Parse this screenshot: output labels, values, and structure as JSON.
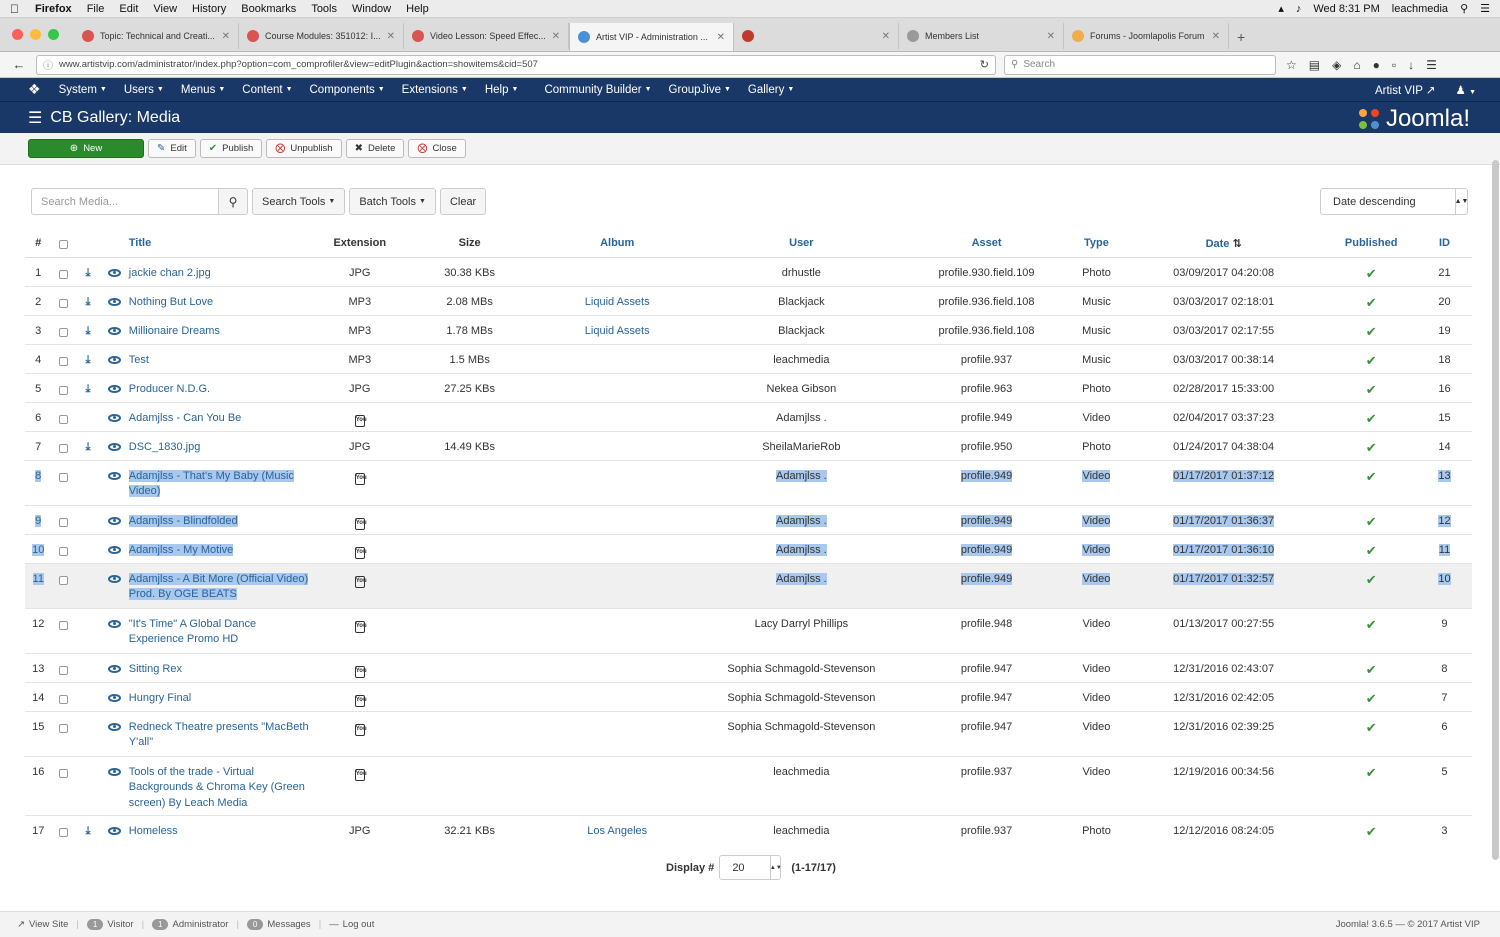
{
  "macbar": {
    "app": "Firefox",
    "menus": [
      "File",
      "Edit",
      "View",
      "History",
      "Bookmarks",
      "Tools",
      "Window",
      "Help"
    ],
    "clock": "Wed 8:31 PM",
    "user": "leachmedia"
  },
  "tabs": [
    {
      "label": "Topic: Technical and Creati...",
      "color": "#d9534f"
    },
    {
      "label": "Course Modules: 351012: I...",
      "color": "#d9534f"
    },
    {
      "label": "Video Lesson: Speed Effec...",
      "color": "#d9534f"
    },
    {
      "label": "Artist VIP - Administration ...",
      "color": "#4a90d9"
    },
    {
      "label": "",
      "color": "#c0392b"
    },
    {
      "label": "Members List",
      "color": "#999999"
    },
    {
      "label": "Forums - Joomlapolis Forum",
      "color": "#f0ad4e"
    }
  ],
  "url": "www.artistvip.com/administrator/index.php?option=com_comprofiler&view=editPlugin&action=showitems&cid=507",
  "search_placeholder": "Search",
  "jnav": {
    "items": [
      "System",
      "Users",
      "Menus",
      "Content",
      "Components",
      "Extensions",
      "Help",
      "Community Builder",
      "GroupJive",
      "Gallery"
    ],
    "site_link": "Artist VIP"
  },
  "page_title": "CB Gallery: Media",
  "brand": "Joomla!",
  "toolbar": {
    "new": "New",
    "edit": "Edit",
    "publish": "Publish",
    "unpublish": "Unpublish",
    "delete": "Delete",
    "close": "Close"
  },
  "filters": {
    "search_placeholder": "Search Media...",
    "search_tools": "Search Tools",
    "batch_tools": "Batch Tools",
    "clear": "Clear",
    "sort": "Date descending"
  },
  "columns": {
    "num": "#",
    "title": "Title",
    "extension": "Extension",
    "size": "Size",
    "album": "Album",
    "user": "User",
    "asset": "Asset",
    "type": "Type",
    "date": "Date",
    "published": "Published",
    "id": "ID"
  },
  "rows": [
    {
      "n": "1",
      "dl": true,
      "title": "jackie chan 2.jpg",
      "ext": "JPG",
      "size": "30.38 KBs",
      "album": "",
      "user": "drhustle",
      "asset": "profile.930.field.109",
      "type": "Photo",
      "date": "03/09/2017 04:20:08",
      "id": "21",
      "sel": false
    },
    {
      "n": "2",
      "dl": true,
      "title": "Nothing But Love",
      "ext": "MP3",
      "size": "2.08 MBs",
      "album": "Liquid Assets",
      "user": "Blackjack",
      "asset": "profile.936.field.108",
      "type": "Music",
      "date": "03/03/2017 02:18:01",
      "id": "20",
      "sel": false
    },
    {
      "n": "3",
      "dl": true,
      "title": "Millionaire Dreams",
      "ext": "MP3",
      "size": "1.78 MBs",
      "album": "Liquid Assets",
      "user": "Blackjack",
      "asset": "profile.936.field.108",
      "type": "Music",
      "date": "03/03/2017 02:17:55",
      "id": "19",
      "sel": false
    },
    {
      "n": "4",
      "dl": true,
      "title": "Test",
      "ext": "MP3",
      "size": "1.5 MBs",
      "album": "",
      "user": "leachmedia",
      "asset": "profile.937",
      "type": "Music",
      "date": "03/03/2017 00:38:14",
      "id": "18",
      "sel": false
    },
    {
      "n": "5",
      "dl": true,
      "title": "Producer N.D.G.",
      "ext": "JPG",
      "size": "27.25 KBs",
      "album": "",
      "user": "Nekea Gibson",
      "asset": "profile.963",
      "type": "Photo",
      "date": "02/28/2017 15:33:00",
      "id": "16",
      "sel": false
    },
    {
      "n": "6",
      "dl": false,
      "title": "Adamjlss - Can You Be",
      "ext": "yt",
      "size": "",
      "album": "",
      "user": "Adamjlss .",
      "asset": "profile.949",
      "type": "Video",
      "date": "02/04/2017 03:37:23",
      "id": "15",
      "sel": false
    },
    {
      "n": "7",
      "dl": true,
      "title": "DSC_1830.jpg",
      "ext": "JPG",
      "size": "14.49 KBs",
      "album": "",
      "user": "SheilaMarieRob",
      "asset": "profile.950",
      "type": "Photo",
      "date": "01/24/2017 04:38:04",
      "id": "14",
      "sel": false
    },
    {
      "n": "8",
      "dl": false,
      "title": "Adamjlss - That's My Baby (Music Video)",
      "ext": "yt",
      "size": "",
      "album": "",
      "user": "Adamjlss .",
      "asset": "profile.949",
      "type": "Video",
      "date": "01/17/2017 01:37:12",
      "id": "13",
      "sel": true
    },
    {
      "n": "9",
      "dl": false,
      "title": "Adamjlss - Blindfolded",
      "ext": "yt",
      "size": "",
      "album": "",
      "user": "Adamjlss .",
      "asset": "profile.949",
      "type": "Video",
      "date": "01/17/2017 01:36:37",
      "id": "12",
      "sel": true
    },
    {
      "n": "10",
      "dl": false,
      "title": "Adamjlss - My Motive",
      "ext": "yt",
      "size": "",
      "album": "",
      "user": "Adamjlss .",
      "asset": "profile.949",
      "type": "Video",
      "date": "01/17/2017 01:36:10",
      "id": "11",
      "sel": true
    },
    {
      "n": "11",
      "dl": false,
      "title": "Adamjlss - A Bit More (Official Video) Prod. By OGE BEATS",
      "ext": "yt",
      "size": "",
      "album": "",
      "user": "Adamjlss .",
      "asset": "profile.949",
      "type": "Video",
      "date": "01/17/2017 01:32:57",
      "id": "10",
      "sel": true
    },
    {
      "n": "12",
      "dl": false,
      "title": "\"It's Time\" A Global Dance Experience Promo HD",
      "ext": "yt",
      "size": "",
      "album": "",
      "user": "Lacy Darryl Phillips",
      "asset": "profile.948",
      "type": "Video",
      "date": "01/13/2017 00:27:55",
      "id": "9",
      "sel": false
    },
    {
      "n": "13",
      "dl": false,
      "title": "Sitting Rex",
      "ext": "yt",
      "size": "",
      "album": "",
      "user": "Sophia Schmagold-Stevenson",
      "asset": "profile.947",
      "type": "Video",
      "date": "12/31/2016 02:43:07",
      "id": "8",
      "sel": false
    },
    {
      "n": "14",
      "dl": false,
      "title": "Hungry Final",
      "ext": "yt",
      "size": "",
      "album": "",
      "user": "Sophia Schmagold-Stevenson",
      "asset": "profile.947",
      "type": "Video",
      "date": "12/31/2016 02:42:05",
      "id": "7",
      "sel": false
    },
    {
      "n": "15",
      "dl": false,
      "title": "Redneck Theatre presents \"MacBeth Y'all\"",
      "ext": "yt",
      "size": "",
      "album": "",
      "user": "Sophia Schmagold-Stevenson",
      "asset": "profile.947",
      "type": "Video",
      "date": "12/31/2016 02:39:25",
      "id": "6",
      "sel": false
    },
    {
      "n": "16",
      "dl": false,
      "title": "Tools of the trade - Virtual Backgrounds & Chroma Key (Green screen) By Leach Media",
      "ext": "yt",
      "size": "",
      "album": "",
      "user": "leachmedia",
      "asset": "profile.937",
      "type": "Video",
      "date": "12/19/2016 00:34:56",
      "id": "5",
      "sel": false
    },
    {
      "n": "17",
      "dl": true,
      "title": "Homeless",
      "ext": "JPG",
      "size": "32.21 KBs",
      "album": "Los Angeles",
      "user": "leachmedia",
      "asset": "profile.937",
      "type": "Photo",
      "date": "12/12/2016 08:24:05",
      "id": "3",
      "sel": false
    }
  ],
  "pager": {
    "label": "Display #",
    "limit": "20",
    "count": "(1-17/17)"
  },
  "status": {
    "view_site": "View Site",
    "visitor_count": "1",
    "visitor": "Visitor",
    "admin_count": "1",
    "admin": "Administrator",
    "messages_count": "0",
    "messages": "Messages",
    "logout": "Log out",
    "version": "Joomla! 3.6.5  —  © 2017 Artist VIP"
  },
  "colors": {
    "nav": "#1a3867",
    "link": "#2a6496",
    "new_button": "#2b8a2b",
    "check": "#3a8f3a",
    "selection": "#a8c8ee"
  }
}
